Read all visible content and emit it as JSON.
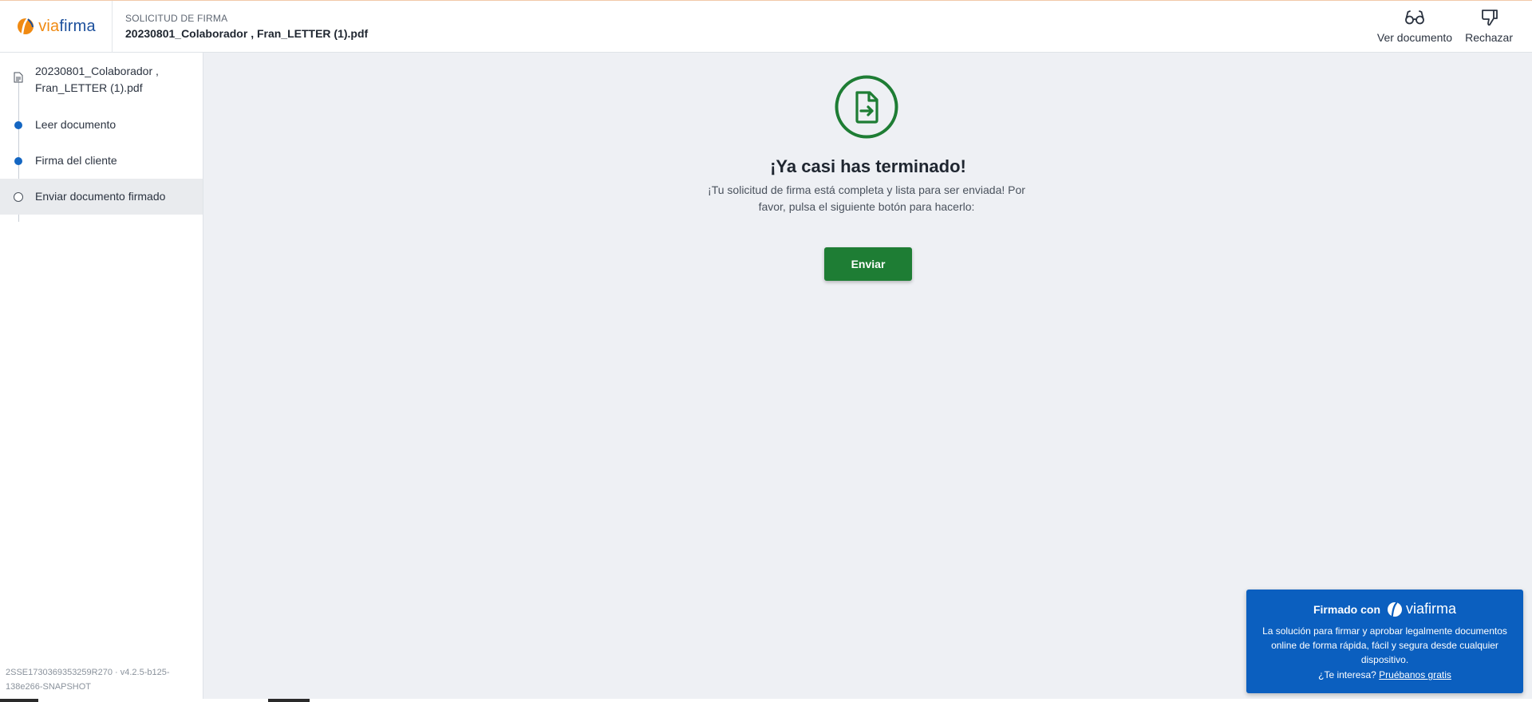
{
  "brand": {
    "logo_via": "via",
    "logo_firma": "firma",
    "accent": "#f08a12",
    "primary": "#1b4f9c"
  },
  "header": {
    "kicker": "SOLICITUD DE FIRMA",
    "title": "20230801_Colaborador , Fran_LETTER (1).pdf",
    "actions": [
      {
        "label": "Ver documento",
        "icon": "glasses-icon"
      },
      {
        "label": "Rechazar",
        "icon": "thumbs-down-icon"
      }
    ]
  },
  "sidebar": {
    "steps": [
      {
        "label": "20230801_Colaborador , Fran_LETTER (1).pdf",
        "icon": "document-icon",
        "state": "file"
      },
      {
        "label": "Leer documento",
        "state": "done"
      },
      {
        "label": "Firma del cliente",
        "state": "done"
      },
      {
        "label": "Enviar documento firmado",
        "state": "current"
      }
    ],
    "version": "2SSE1730369353259R270 · v4.2.5-b125-138e266-SNAPSHOT"
  },
  "main": {
    "icon": "document-arrow-icon",
    "title": "¡Ya casi has terminado!",
    "message": "¡Tu solicitud de firma está completa y lista para ser enviada! Por favor, pulsa el siguiente botón para hacerlo:",
    "send_label": "Enviar",
    "success_color": "#1e7d34"
  },
  "promo": {
    "signed_with": "Firmado con",
    "brand": "viafirma",
    "description": "La solución para firmar y aprobar legalmente documentos online de forma rápida, fácil y segura desde cualquier dispositivo.",
    "question": "¿Te interesa?",
    "link": "Pruébanos gratis",
    "background": "#0b5fbf"
  }
}
